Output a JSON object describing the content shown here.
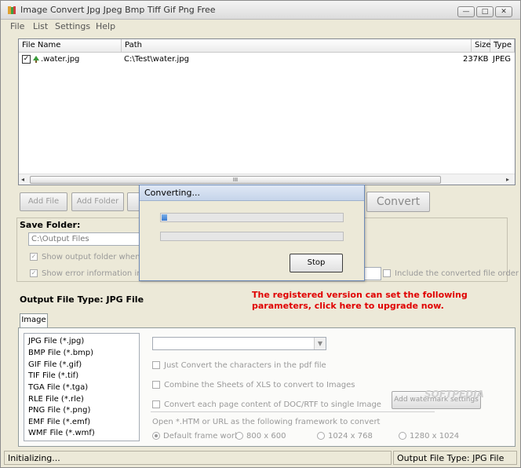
{
  "window": {
    "title": "Image Convert Jpg Jpeg Bmp Tiff Gif Png Free",
    "minimize_glyph": "—",
    "maximize_glyph": "□",
    "close_glyph": "✕"
  },
  "menu": [
    "File",
    "List",
    "Settings",
    "Help"
  ],
  "file_list": {
    "columns": [
      "File Name",
      "Path",
      "Size",
      "Type"
    ],
    "rows": [
      {
        "checked": true,
        "name": ".water.jpg",
        "path": "C:\\Test\\water.jpg",
        "size": "237KB",
        "type": "JPEG"
      }
    ],
    "checkmark": "✓",
    "scroll_left": "◂",
    "scroll_right": "▸",
    "scroll_grip": "III"
  },
  "toolbar": {
    "add_file": "Add File",
    "add_folder": "Add Folder",
    "convert": "Convert"
  },
  "save_folder": {
    "title": "Save Folder:",
    "path": "C:\\Output Files",
    "show_output_label": "Show output folder when done",
    "show_error_label": "Show error information in conv",
    "include_label": "Include the converted file order",
    "check_glyph": "✓"
  },
  "output_type": "Output File Type:  JPG File",
  "promo_text": "The registered version can set the following parameters, click here to upgrade now.",
  "tabs": [
    "Image"
  ],
  "file_types": [
    "JPG File  (*.jpg)",
    "BMP File  (*.bmp)",
    "GIF File  (*.gif)",
    "TIF File  (*.tif)",
    "TGA File  (*.tga)",
    "RLE File  (*.rle)",
    "PNG File  (*.png)",
    "EMF File  (*.emf)",
    "WMF File  (*.wmf)"
  ],
  "options": {
    "pdf_chars": "Just Convert the characters in the pdf file",
    "xls_combine": "Combine the Sheets of XLS to convert to Images",
    "doc_each_page": "Convert each page content of DOC/RTF to single Image",
    "watermark_button": "Add watermark settings",
    "htm_label": "Open *.HTM or URL as the following framework to convert",
    "frameworks": [
      "Default frame work",
      "800 x 600",
      "1024 x 768",
      "1280 x 1024"
    ],
    "combo_arrow": "▼"
  },
  "status": {
    "left": "Initializing...",
    "right": "Output File Type:  JPG File"
  },
  "dialog": {
    "title": "Converting...",
    "progress": 0.03,
    "progress2": 0,
    "stop": "Stop"
  },
  "watermark_text": "SOFTPEDIA"
}
